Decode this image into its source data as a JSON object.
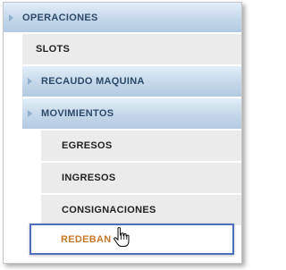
{
  "menu": {
    "items": [
      {
        "label": "OPERACIONES",
        "type": "group"
      },
      {
        "label": "SLOTS",
        "type": "item"
      },
      {
        "label": "RECAUDO MAQUINA",
        "type": "group"
      },
      {
        "label": "MOVIMIENTOS",
        "type": "group"
      },
      {
        "label": "EGRESOS",
        "type": "subitem"
      },
      {
        "label": "INGRESOS",
        "type": "subitem"
      },
      {
        "label": "CONSIGNACIONES",
        "type": "subitem"
      },
      {
        "label": "REDEBAN",
        "type": "subitem",
        "state": "hovered"
      }
    ]
  },
  "colors": {
    "group_gradient_top": "#e3eef8",
    "group_gradient_bottom": "#b3cae2",
    "group_text": "#2b4a6a",
    "item_background": "#ebebeb",
    "hover_border": "#4d6fbe",
    "hover_text": "#c8782b"
  },
  "icons": {
    "expand": "triangle-right-icon",
    "cursor": "hand-pointer-icon"
  }
}
